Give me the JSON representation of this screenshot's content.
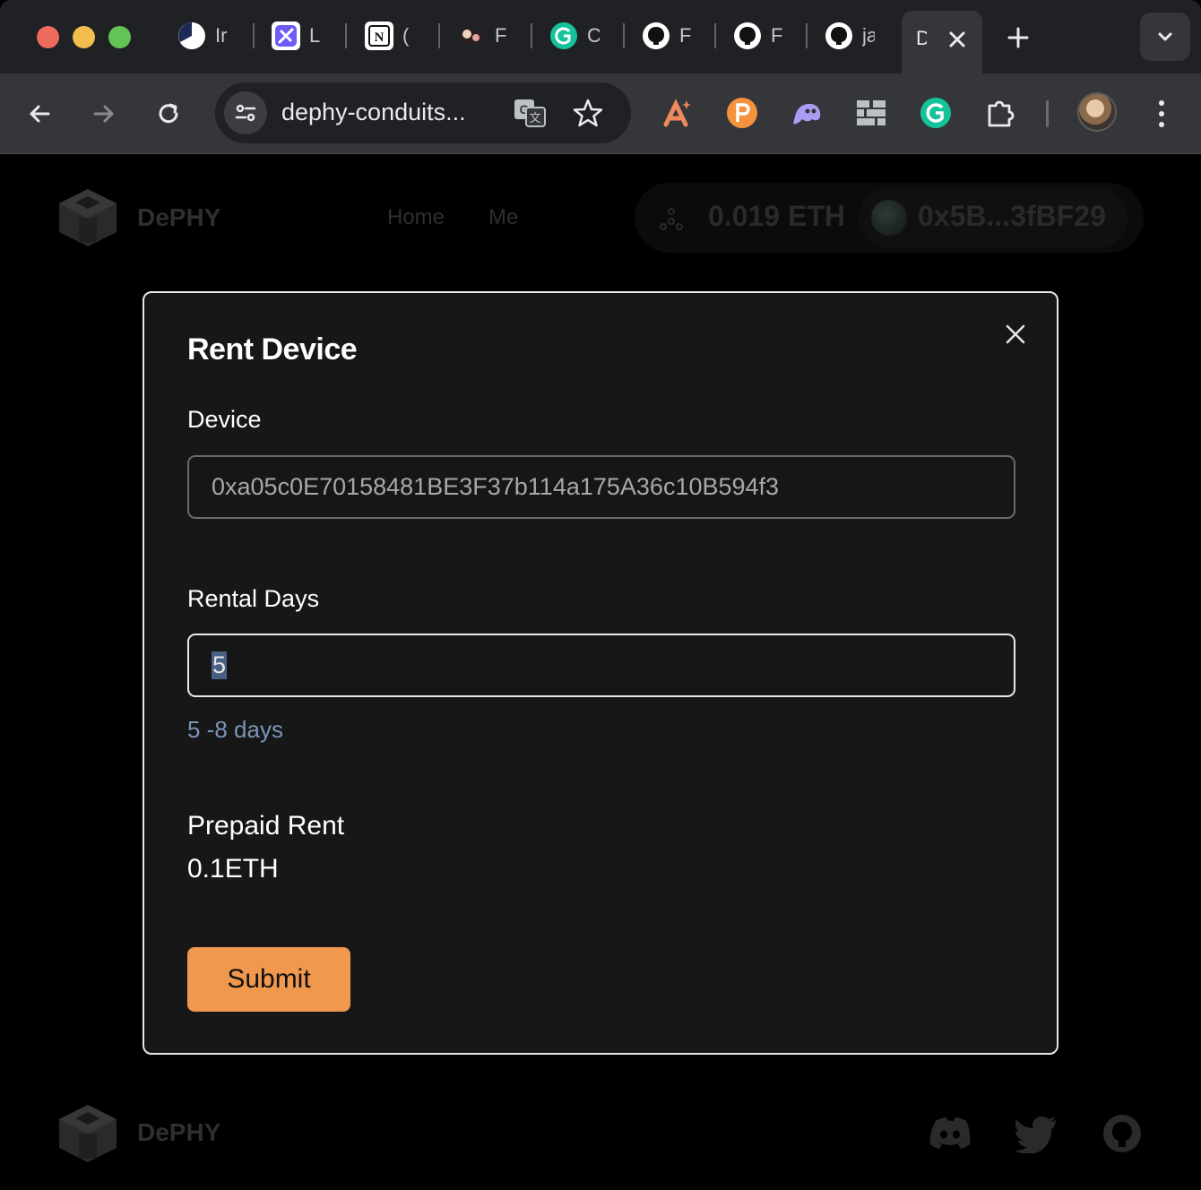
{
  "browser": {
    "tabs": [
      {
        "favicon": "pie-chart-icon",
        "title_fragment": "Ir"
      },
      {
        "favicon": "linear-app-icon",
        "title_fragment": "L"
      },
      {
        "favicon": "notion-icon",
        "title_fragment": "("
      },
      {
        "favicon": "anime-avatar-icon",
        "title_fragment": "F"
      },
      {
        "favicon": "grammarly-icon",
        "title_fragment": "C"
      },
      {
        "favicon": "github-icon",
        "title_fragment": "F"
      },
      {
        "favicon": "github-icon",
        "title_fragment": "F"
      },
      {
        "favicon": "github-icon",
        "title_fragment": "ja"
      }
    ],
    "active_tab": {
      "title_fragment": "D",
      "close": "×"
    },
    "omnibox": {
      "url": "dephy-conduits..."
    },
    "extensions": [
      "spark-icon",
      "p-coin-icon",
      "ghost-icon",
      "grid-icon",
      "grammarly-icon",
      "puzzle-icon"
    ]
  },
  "navbar": {
    "brand": "DePHY",
    "links": [
      "Home",
      "Me"
    ],
    "balance": "0.019 ETH",
    "address": "0x5B...3fBF29"
  },
  "modal": {
    "title": "Rent Device",
    "device_label": "Device",
    "device_value": "0xa05c0E70158481BE3F37b114a175A36c10B594f3",
    "days_label": "Rental Days",
    "days_value": "5",
    "days_hint": "5 -8 days",
    "prepaid_label": "Prepaid Rent",
    "prepaid_value": "0.1ETH",
    "submit_label": "Submit"
  },
  "footer": {
    "brand": "DePHY",
    "social": [
      "discord-icon",
      "twitter-icon",
      "github-icon"
    ]
  },
  "colors": {
    "accent": "#f0984d",
    "modal_bg": "#171718",
    "hint": "#7a95b8"
  }
}
